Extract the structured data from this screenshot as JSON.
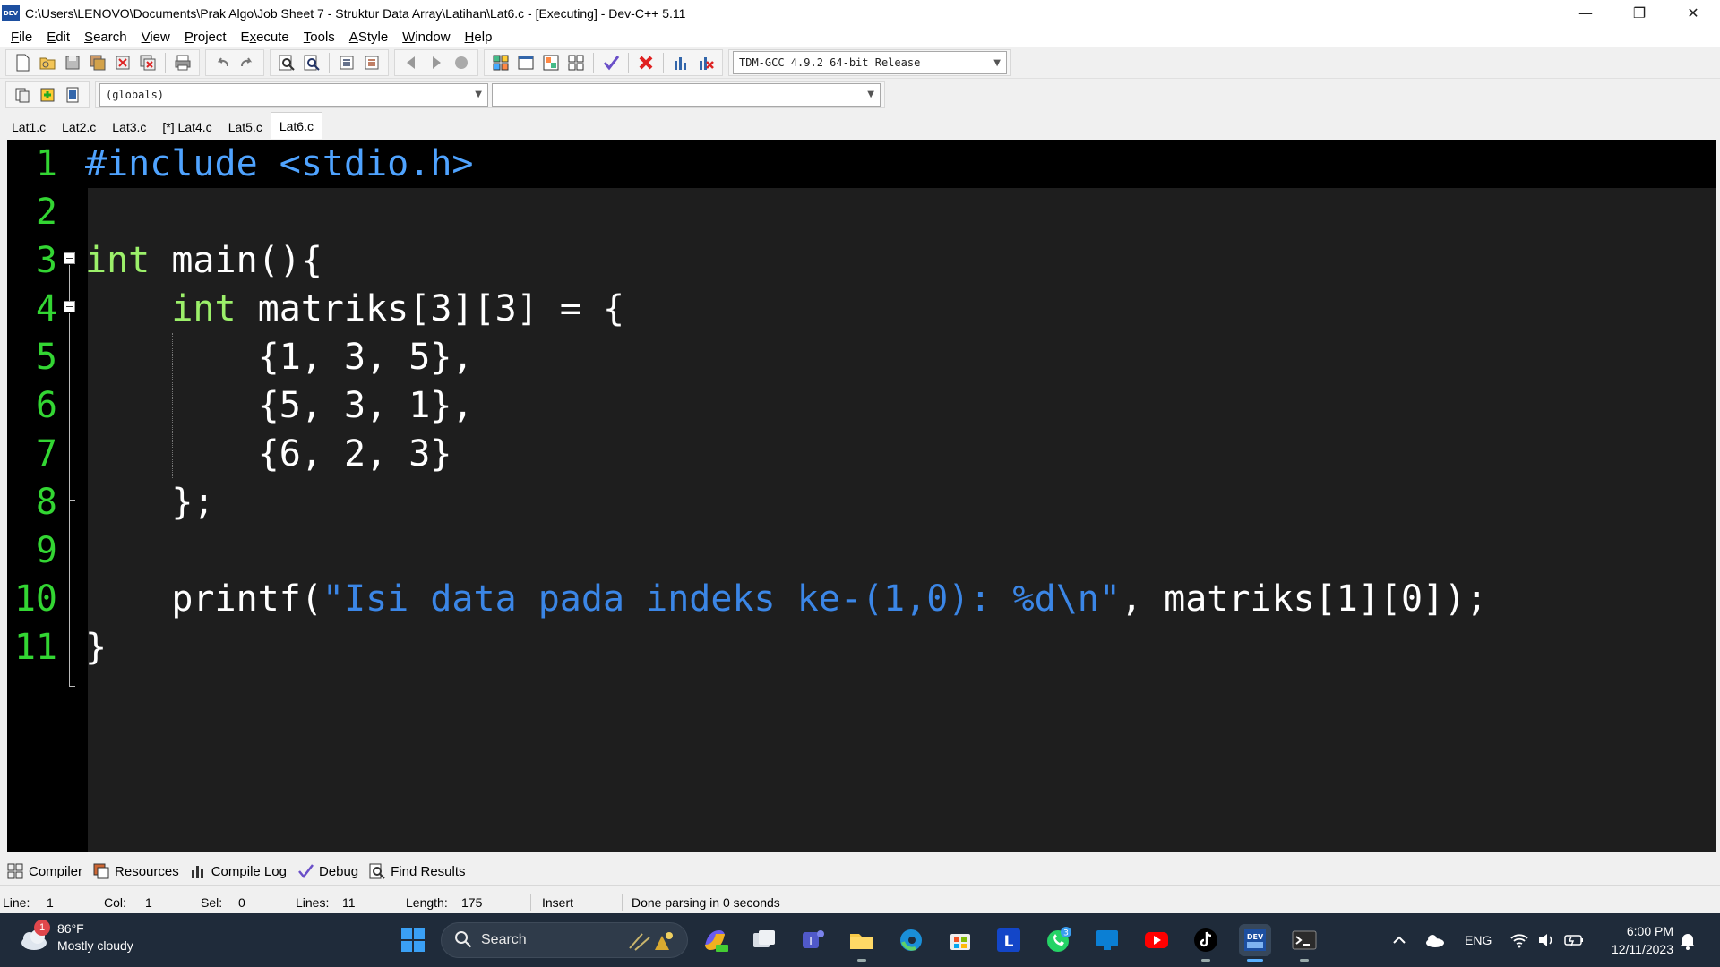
{
  "window": {
    "title": "C:\\Users\\LENOVO\\Documents\\Prak Algo\\Job Sheet 7 - Struktur Data Array\\Latihan\\Lat6.c - [Executing] - Dev-C++ 5.11",
    "app_icon_text": "DEV",
    "controls": {
      "minimize": "—",
      "restore": "❐",
      "close": "✕"
    }
  },
  "menu": [
    {
      "label": "File",
      "key": "F"
    },
    {
      "label": "Edit",
      "key": "E"
    },
    {
      "label": "Search",
      "key": "S"
    },
    {
      "label": "View",
      "key": "V"
    },
    {
      "label": "Project",
      "key": "P"
    },
    {
      "label": "Execute",
      "key": "x"
    },
    {
      "label": "Tools",
      "key": "T"
    },
    {
      "label": "AStyle",
      "key": "A"
    },
    {
      "label": "Window",
      "key": "W"
    },
    {
      "label": "Help",
      "key": "H"
    }
  ],
  "toolbar": {
    "compiler_select": "TDM-GCC 4.9.2 64-bit Release",
    "scope_select": "(globals)",
    "symbol_select": ""
  },
  "file_tabs": [
    {
      "label": "Lat1.c",
      "active": false
    },
    {
      "label": "Lat2.c",
      "active": false
    },
    {
      "label": "Lat3.c",
      "active": false
    },
    {
      "label": "[*] Lat4.c",
      "active": false
    },
    {
      "label": "Lat5.c",
      "active": false
    },
    {
      "label": "Lat6.c",
      "active": true
    }
  ],
  "editor": {
    "line_numbers": [
      "1",
      "2",
      "3",
      "4",
      "5",
      "6",
      "7",
      "8",
      "9",
      "10",
      "11"
    ],
    "colors": {
      "keyword": "#9cf06a",
      "preprocessor": "#4fa3ff",
      "string": "#3b86e6",
      "line_number": "#33d633",
      "background": "#1e1e1e"
    },
    "lines": [
      [
        {
          "t": "#include <stdio.h>",
          "c": "pp"
        }
      ],
      [],
      [
        {
          "t": "int",
          "c": "kw"
        },
        {
          "t": " main(){",
          "c": ""
        }
      ],
      [
        {
          "t": "    ",
          "c": ""
        },
        {
          "t": "int",
          "c": "kw"
        },
        {
          "t": " matriks[3][3] = {",
          "c": ""
        }
      ],
      [
        {
          "t": "        {1, 3, 5},",
          "c": ""
        }
      ],
      [
        {
          "t": "        {5, 3, 1},",
          "c": ""
        }
      ],
      [
        {
          "t": "        {6, 2, 3}",
          "c": ""
        }
      ],
      [
        {
          "t": "    };",
          "c": ""
        }
      ],
      [],
      [
        {
          "t": "    printf(",
          "c": ""
        },
        {
          "t": "\"Isi data pada indeks ke-(1,0): %d\\n\"",
          "c": "str"
        },
        {
          "t": ", matriks[1][0]);",
          "c": ""
        }
      ],
      [
        {
          "t": "}",
          "c": ""
        }
      ]
    ]
  },
  "bottom_tabs": [
    {
      "label": "Compiler",
      "icon": "compiler-grid-icon"
    },
    {
      "label": "Resources",
      "icon": "resources-icon"
    },
    {
      "label": "Compile Log",
      "icon": "compile-log-chart-icon"
    },
    {
      "label": "Debug",
      "icon": "debug-check-icon"
    },
    {
      "label": "Find Results",
      "icon": "find-results-icon"
    }
  ],
  "status": {
    "line_label": "Line:",
    "line_value": "1",
    "col_label": "Col:",
    "col_value": "1",
    "sel_label": "Sel:",
    "sel_value": "0",
    "lines_label": "Lines:",
    "lines_value": "11",
    "length_label": "Length:",
    "length_value": "175",
    "mode": "Insert",
    "message": "Done parsing in 0 seconds"
  },
  "taskbar": {
    "weather_temp": "86°F",
    "weather_desc": "Mostly cloudy",
    "weather_badge": "1",
    "search_label": "Search",
    "whatsapp_badge": "3",
    "language": "ENG",
    "time": "6:00 PM",
    "date": "12/11/2023",
    "pinned": [
      "windows-start-icon",
      "search-icon",
      "snipping-tool-icon",
      "copilot-pre-icon",
      "task-view-icon",
      "teams-icon",
      "file-explorer-icon",
      "edge-icon",
      "microsoft-store-icon",
      "l-app-icon",
      "whatsapp-icon",
      "windows-app-icon",
      "youtube-icon",
      "tiktok-icon",
      "devcpp-icon",
      "terminal-icon"
    ]
  }
}
